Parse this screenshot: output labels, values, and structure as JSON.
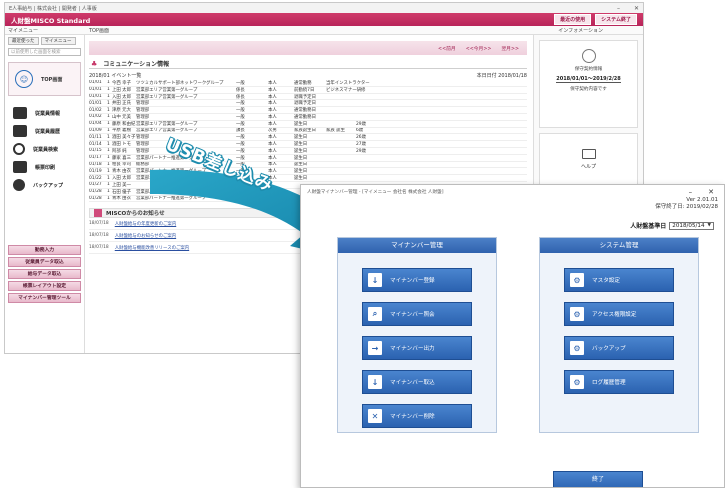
{
  "back_window": {
    "titlebar": "E人事給与 | 株式会社 | 開発者 | 人事版",
    "app_title": "人財盤MISCO Standard",
    "header_buttons": [
      "最近の使用",
      "システム終了"
    ],
    "menubar_left": "マイメニュー",
    "menubar_tab": "TOP画面",
    "menubar_right": "インフォメーション",
    "sidebar": {
      "tabs": [
        "最近使った",
        "マイメニュー"
      ],
      "search_placeholder": "以前使用した画面を検索",
      "top_label": "TOP画面",
      "nav": [
        "従業員情報",
        "従業員履歴",
        "従業員検索",
        "帳票印刷",
        "バックアップ"
      ],
      "buttons": [
        "勤務入力",
        "従業員データ取込",
        "給与データ取込",
        "帳票レイアウト設定",
        "マイナンバー管理ツール"
      ]
    },
    "main": {
      "banner_links": [
        "<<前月",
        "<<今月>>",
        "翌月>>"
      ],
      "comm_title": "コミュニケーション情報",
      "events_title": "2018/01 イベント一覧",
      "events_right": "本日日付 2018/01/18",
      "events": [
        [
          "01/01",
          "1",
          "今西 幸子",
          "ツツミカルサポート部ネットワークグループ",
          "一般",
          "本人",
          "通常勤務",
          "当年インストラクター",
          ""
        ],
        [
          "01/01",
          "1",
          "上田 太郎",
          "営業部エリア営業第一グループ",
          "係長",
          "本人",
          "前勤続7日",
          "ビジネスマナー研修",
          ""
        ],
        [
          "01/01",
          "1",
          "入田 太郎",
          "営業部エリア営業第一グループ",
          "係長",
          "本人",
          "退職予定日",
          "",
          ""
        ],
        [
          "01/01",
          "1",
          "井田 正氏",
          "管理部",
          "一般",
          "本人",
          "退職予定日",
          "",
          ""
        ],
        [
          "01/02",
          "1",
          "津原 元大",
          "管理部",
          "一般",
          "本人",
          "通常勤務日",
          "",
          ""
        ],
        [
          "01/02",
          "1",
          "山中 元美",
          "管理部",
          "一般",
          "本人",
          "通常勤務日",
          "",
          ""
        ],
        [
          "01/04",
          "1",
          "藤原 和由紀",
          "営業部エリア営業第一グループ",
          "一般",
          "本人",
          "誕生日",
          "",
          "29歳"
        ],
        [
          "01/09",
          "1",
          "平原 義樹",
          "営業部エリア営業第一グループ",
          "課長",
          "次男",
          "家族誕生日",
          "家族 誕生",
          "6歳"
        ],
        [
          "01/11",
          "1",
          "酒田 美々子",
          "管理部",
          "一般",
          "本人",
          "誕生日",
          "",
          "26歳"
        ],
        [
          "01/14",
          "1",
          "酒田 トモ",
          "管理部",
          "一般",
          "本人",
          "誕生日",
          "",
          "27歳"
        ],
        [
          "01/15",
          "1",
          "阿部 純",
          "管理部",
          "一般",
          "本人",
          "誕生日",
          "",
          "29歳"
        ],
        [
          "01/17",
          "1",
          "藤家 喜三",
          "営業部パートナー推進第一グループ",
          "一般",
          "本人",
          "誕生日",
          "",
          ""
        ],
        [
          "01/18",
          "1",
          "相良 幸司",
          "総務部",
          "一般",
          "本人",
          "誕生日",
          "",
          ""
        ],
        [
          "01/19",
          "1",
          "青木 由衣",
          "営業部パートナー推進第一グループ",
          "一般",
          "本人",
          "誕生日",
          "",
          ""
        ],
        [
          "01/22",
          "1",
          "入田 太郎",
          "営業部エリア営業第一グループ",
          "一般",
          "本人",
          "誕生日",
          "",
          ""
        ],
        [
          "01/27",
          "1",
          "上田 美一",
          "",
          "",
          "",
          "",
          "",
          ""
        ],
        [
          "01/28",
          "1",
          "石田 優子",
          "営業部パートナー推進第一グループ",
          "",
          "",
          "",
          "",
          ""
        ],
        [
          "01/28",
          "1",
          "青木 由衣",
          "営業部パートナー推進第一グループ",
          "",
          "",
          "",
          "",
          ""
        ]
      ],
      "misco_title": "MISCOからのお知らせ",
      "news": [
        {
          "date": "18/07/18",
          "text": "人財盤給与の年度更新のご案内"
        },
        {
          "date": "18/07/18",
          "text": "人財盤給与のお知らせのご案内"
        },
        {
          "date": "18/07/18",
          "text": "人財盤給与機能改善リリースのご案内"
        }
      ]
    },
    "right": {
      "status_a": "保守契約情報",
      "status_b": "2018/01/01～2019/2/28",
      "status_c": "保守契約内容です",
      "help_label": "ヘルプ"
    }
  },
  "usb_label": "USB差し込み",
  "front_window": {
    "titlebar": "人財盤マイナンバー管理 - [マイメニュー 会社名 株式会社 人財盤]",
    "version": "Ver 2.01.01",
    "maintenance": "保守終了日: 2019/02/28",
    "base_date_label": "人財盤基準日",
    "base_date_value": "2018/05/14",
    "left_panel": {
      "header": "マイナンバー管理",
      "tiles": [
        "マイナンバー登録",
        "マイナンバー照会",
        "マイナンバー出力",
        "マイナンバー取込",
        "マイナンバー削除"
      ]
    },
    "right_panel": {
      "header": "システム管理",
      "tiles": [
        "マスタ設定",
        "アクセス権限設定",
        "バックアップ",
        "ログ履歴管理"
      ]
    },
    "exit_label": "終了"
  },
  "colors": {
    "brand_pink": "#c42f62",
    "panel_blue": "#2f62ae",
    "arrow_teal": "#1a9bbf"
  }
}
